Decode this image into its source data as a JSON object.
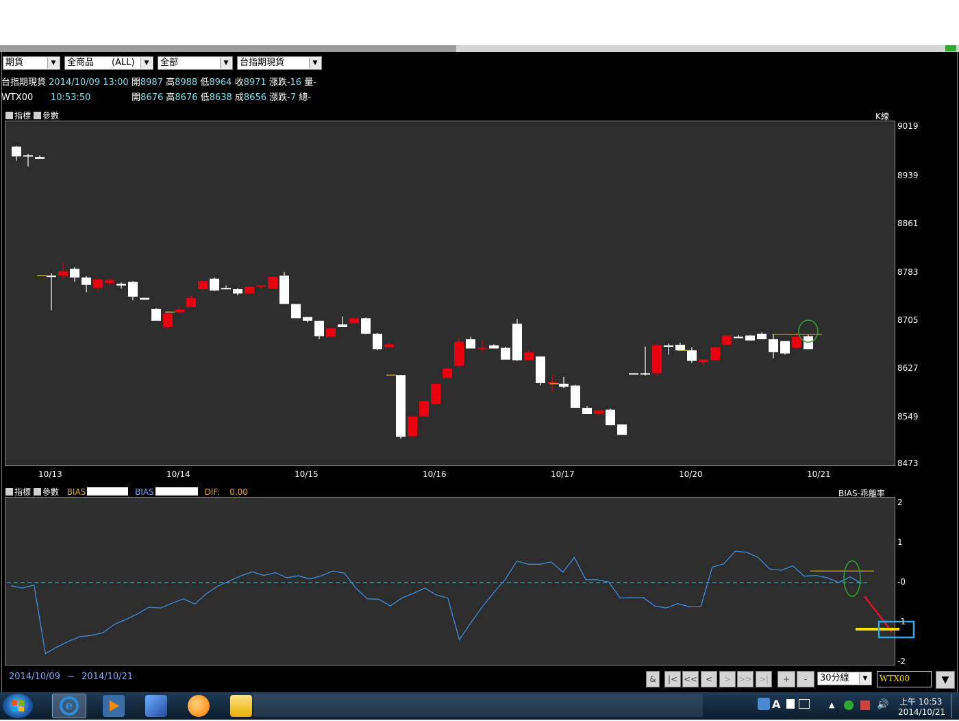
{
  "selectors": [
    {
      "value": "期貨"
    },
    {
      "value": "全商品　　(ALL)"
    },
    {
      "value": "全部"
    },
    {
      "value": "台指期現貨"
    }
  ],
  "quote_row1": {
    "name": "台指期現貨",
    "datetime": "2014/10/09 13:00",
    "open_label": "開",
    "open": "8987",
    "high_label": "高",
    "high": "8988",
    "low_label": "低",
    "low": "8964",
    "close_label": "收",
    "close": "8971",
    "chg_label": "漲跌",
    "chg": "-16",
    "vol_label": "量",
    "vol": "-"
  },
  "quote_row2": {
    "name": "WTX00",
    "time": "10:53:50",
    "open_label": "開",
    "open": "8676",
    "high_label": "高",
    "high": "8676",
    "low_label": "低",
    "low": "8638",
    "deal_label": "成",
    "deal": "8656",
    "chg_label": "漲跌",
    "chg": "-7",
    "total_label": "總",
    "total": "-"
  },
  "main_panel": {
    "indicator_label": "指標",
    "param_label": "參數",
    "chart_name": "K線"
  },
  "sub_panel": {
    "indicator_label": "指標",
    "param_label": "參數",
    "bias1_label": "BIAS",
    "bias2_label": "BIAS",
    "dif_label": "DIF:",
    "dif_value": "0.00",
    "chart_name": "BIAS-乖離率"
  },
  "footer": {
    "range_start": "2014/10/09",
    "range_sep": "~",
    "range_end": "2014/10/21",
    "buttons": [
      "&",
      "|<",
      "<<",
      "<",
      ">",
      ">>",
      ">|",
      "+",
      "-"
    ],
    "interval": "30分線",
    "symbol": "WTX00"
  },
  "taskbar": {
    "time": "上午 10:53",
    "date": "2014/10/21"
  },
  "colors": {
    "up": "#e8000f",
    "down": "#ffffff",
    "bias": "#3d8ee0",
    "zero": "#3ec8d8",
    "bg": "#2d2d2d"
  },
  "chart_data": [
    {
      "type": "candlestick",
      "title": "K線",
      "ylim": [
        8473,
        9019
      ],
      "yticks": [
        9019,
        8939,
        8861,
        8783,
        8705,
        8627,
        8549,
        8473
      ],
      "xtick_labels": [
        "10/13",
        "10/14",
        "10/15",
        "10/16",
        "10/17",
        "10/20",
        "10/21"
      ],
      "candles": [
        [
          8987,
          8988,
          8964,
          8971
        ],
        [
          8973,
          8975,
          8955,
          8971
        ],
        [
          8970,
          8973,
          8968,
          8967
        ],
        [
          8778,
          8782,
          8722,
          8778
        ],
        [
          8778,
          8798,
          8773,
          8785
        ],
        [
          8789,
          8792,
          8768,
          8775
        ],
        [
          8775,
          8777,
          8751,
          8763
        ],
        [
          8758,
          8769,
          8753,
          8772
        ],
        [
          8766,
          8773,
          8763,
          8771
        ],
        [
          8765,
          8767,
          8757,
          8762
        ],
        [
          8768,
          8769,
          8738,
          8744
        ],
        [
          8742,
          8742,
          8740,
          8739
        ],
        [
          8724,
          8725,
          8705,
          8705
        ],
        [
          8695,
          8720,
          8691,
          8717
        ],
        [
          8719,
          8727,
          8717,
          8723
        ],
        [
          8727,
          8745,
          8727,
          8742
        ],
        [
          8756,
          8770,
          8754,
          8769
        ],
        [
          8773,
          8775,
          8753,
          8754
        ],
        [
          8758,
          8762,
          8757,
          8756
        ],
        [
          8756,
          8758,
          8746,
          8749
        ],
        [
          8749,
          8760,
          8749,
          8760
        ],
        [
          8760,
          8762,
          8757,
          8762
        ],
        [
          8757,
          8776,
          8757,
          8776
        ],
        [
          8778,
          8784,
          8747,
          8732
        ],
        [
          8732,
          8732,
          8716,
          8709
        ],
        [
          8711,
          8711,
          8702,
          8705
        ],
        [
          8705,
          8705,
          8675,
          8680
        ],
        [
          8679,
          8693,
          8679,
          8693
        ],
        [
          8699,
          8712,
          8699,
          8695
        ],
        [
          8701,
          8708,
          8701,
          8709
        ],
        [
          8709,
          8710,
          8683,
          8684
        ],
        [
          8684,
          8685,
          8657,
          8659
        ],
        [
          8662,
          8669,
          8662,
          8667
        ],
        [
          8617,
          8617,
          8514,
          8517
        ],
        [
          8518,
          8520,
          8516,
          8550
        ],
        [
          8550,
          8559,
          8550,
          8575
        ],
        [
          8570,
          8602,
          8570,
          8603
        ],
        [
          8612,
          8617,
          8612,
          8628
        ],
        [
          8632,
          8677,
          8630,
          8671
        ],
        [
          8675,
          8679,
          8661,
          8660
        ],
        [
          8659,
          8674,
          8655,
          8661
        ],
        [
          8665,
          8667,
          8664,
          8660
        ],
        [
          8661,
          8663,
          8642,
          8642
        ],
        [
          8700,
          8708,
          8640,
          8641
        ],
        [
          8641,
          8658,
          8641,
          8654
        ],
        [
          8647,
          8647,
          8600,
          8604
        ],
        [
          8605,
          8618,
          8590,
          8606
        ],
        [
          8603,
          8614,
          8596,
          8598
        ],
        [
          8600,
          8601,
          8572,
          8564
        ],
        [
          8564,
          8567,
          8555,
          8554
        ],
        [
          8554,
          8558,
          8551,
          8560
        ],
        [
          8561,
          8563,
          8542,
          8536
        ],
        [
          8537,
          8537,
          8520,
          8520
        ],
        [
          8620,
          8620,
          8618,
          8620
        ],
        [
          8620,
          8663,
          8616,
          8620
        ],
        [
          8620,
          8667,
          8615,
          8665
        ],
        [
          8665,
          8668,
          8650,
          8664
        ],
        [
          8666,
          8669,
          8661,
          8657
        ],
        [
          8657,
          8662,
          8637,
          8640
        ],
        [
          8638,
          8640,
          8634,
          8642
        ],
        [
          8641,
          8663,
          8641,
          8662
        ],
        [
          8666,
          8680,
          8666,
          8681
        ],
        [
          8679,
          8682,
          8677,
          8678
        ],
        [
          8681,
          8682,
          8674,
          8673
        ],
        [
          8684,
          8686,
          8677,
          8675
        ],
        [
          8675,
          8683,
          8644,
          8654
        ],
        [
          8672,
          8672,
          8650,
          8652
        ],
        [
          8661,
          8685,
          8658,
          8679
        ],
        [
          8680,
          8682,
          8659,
          8659
        ]
      ]
    },
    {
      "type": "line",
      "title": "BIAS-乖離率",
      "ylim": [
        -2,
        2
      ],
      "ytick_labels": [
        "2",
        "1",
        "-0",
        "-1",
        "-2"
      ],
      "series": [
        {
          "values": [
            -0.08,
            -0.14,
            -0.06,
            -1.79,
            -1.62,
            -1.48,
            -1.36,
            -1.33,
            -1.26,
            -1.05,
            -0.93,
            -0.79,
            -0.62,
            -0.64,
            -0.52,
            -0.41,
            -0.54,
            -0.28,
            -0.09,
            0.04,
            0.17,
            0.27,
            0.18,
            0.25,
            0.12,
            0.17,
            0.09,
            0.17,
            0.29,
            0.24,
            -0.14,
            -0.41,
            -0.42,
            -0.59,
            -0.39,
            -0.27,
            -0.14,
            -0.31,
            -0.39,
            -1.44,
            -1.01,
            -0.61,
            -0.25,
            0.08,
            0.54,
            0.46,
            0.46,
            0.52,
            0.26,
            0.63,
            0.07,
            0.07,
            0.01,
            -0.39,
            -0.38,
            -0.38,
            -0.59,
            -0.64,
            -0.53,
            -0.61,
            -0.61,
            0.39,
            0.47,
            0.79,
            0.76,
            0.63,
            0.34,
            0.31,
            0.42,
            0.16,
            0.18,
            0.12,
            0.0,
            0.14,
            -0.02
          ]
        }
      ]
    }
  ]
}
